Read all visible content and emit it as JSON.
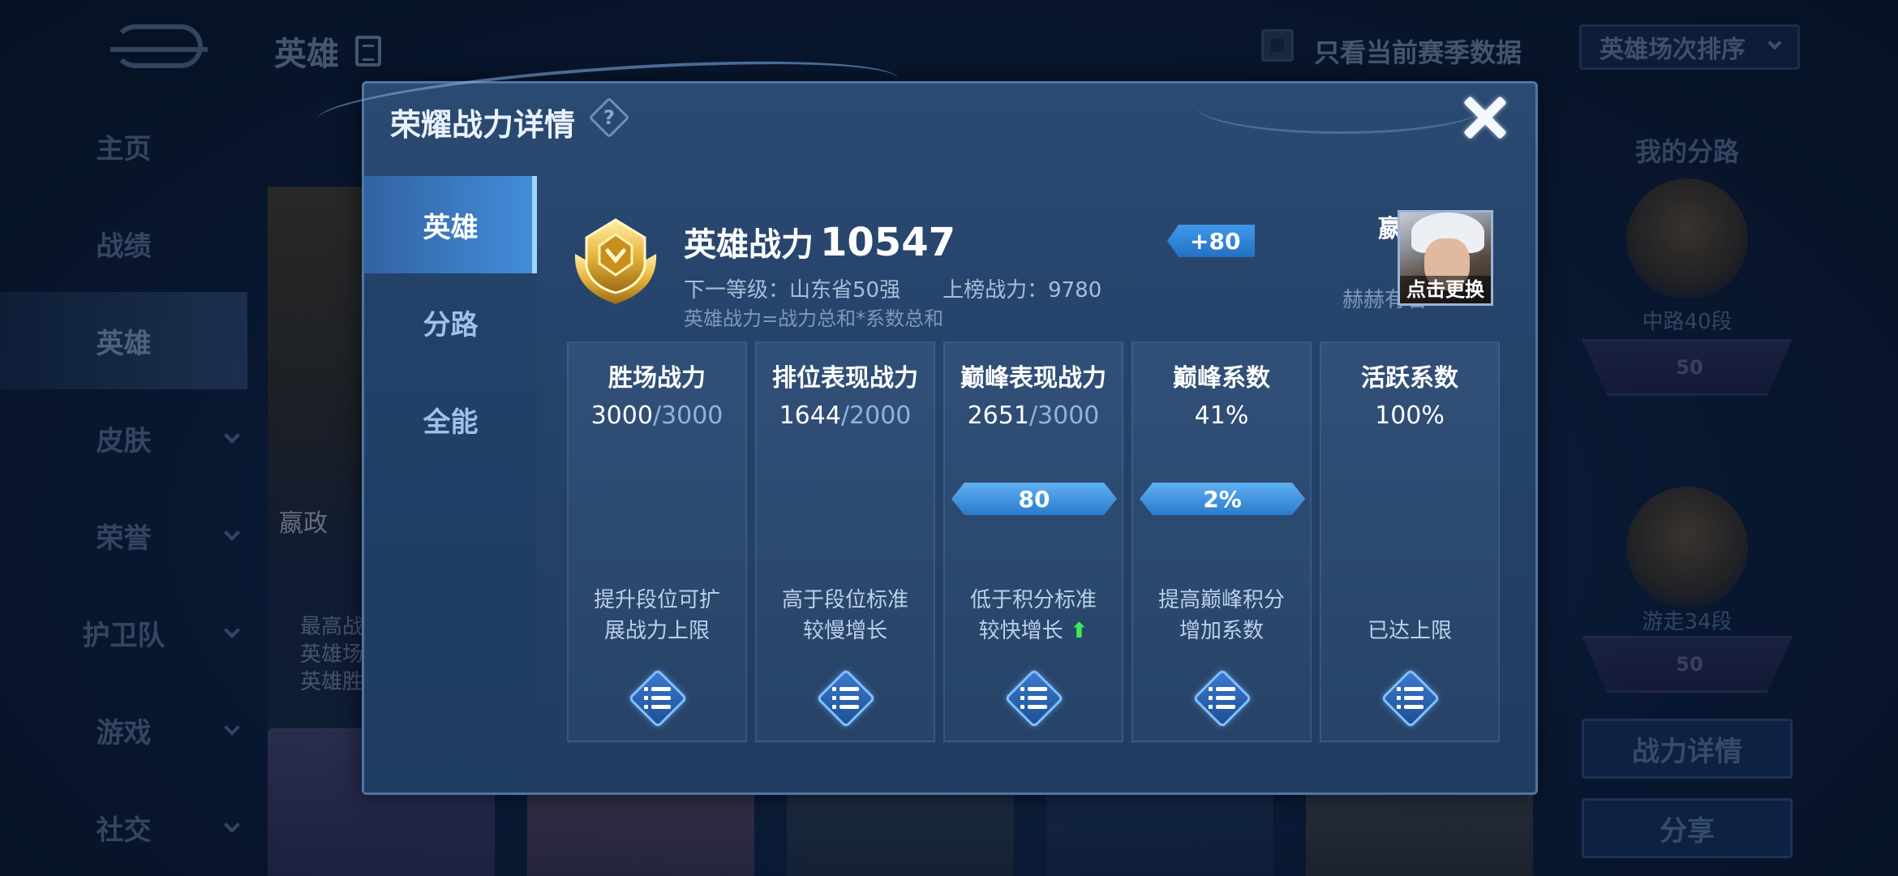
{
  "background": {
    "page_title": "英雄",
    "nav": [
      {
        "label": "主页",
        "has_chevron": false
      },
      {
        "label": "战绩",
        "has_chevron": false
      },
      {
        "label": "英雄",
        "has_chevron": false,
        "active": true
      },
      {
        "label": "皮肤",
        "has_chevron": true
      },
      {
        "label": "荣誉",
        "has_chevron": true
      },
      {
        "label": "护卫队",
        "has_chevron": true
      },
      {
        "label": "游戏",
        "has_chevron": true
      },
      {
        "label": "社交",
        "has_chevron": true
      }
    ],
    "filter_label": "只看当前赛季数据",
    "sort_label": "英雄场次排序",
    "hero_card_name": "嬴政",
    "hero_card_text": [
      "最高战",
      "英雄场",
      "英雄胜"
    ],
    "right_panel": {
      "title": "我的分路",
      "rank1_label": "中路40段",
      "rank1_plate": "50",
      "rank2_label": "游走34段",
      "rank2_plate": "50",
      "btn_detail": "战力详情",
      "btn_share": "分享"
    }
  },
  "modal": {
    "title": "荣耀战力详情",
    "help": "?",
    "tabs": [
      {
        "label": "英雄",
        "active": true
      },
      {
        "label": "分路",
        "active": false
      },
      {
        "label": "全能",
        "active": false
      }
    ],
    "summary": {
      "power_label": "英雄战力",
      "power_value": "10547",
      "delta": "+80",
      "next_level": "下一等级：山东省50强",
      "rank_power": "上榜战力：9780",
      "formula": "英雄战力=战力总和*系数总和"
    },
    "hero": {
      "name": "嬴政",
      "title": "赫赫有名",
      "change_label": "点击更换"
    },
    "stats": [
      {
        "title": "胜场战力",
        "current": "3000",
        "max": "/3000",
        "ribbon": null,
        "note": [
          "提升段位可扩",
          "展战力上限"
        ],
        "up_arrow": false
      },
      {
        "title": "排位表现战力",
        "current": "1644",
        "max": "/2000",
        "ribbon": null,
        "note": [
          "高于段位标准",
          "较慢增长"
        ],
        "up_arrow": false
      },
      {
        "title": "巅峰表现战力",
        "current": "2651",
        "max": "/3000",
        "ribbon": "80",
        "note": [
          "低于积分标准",
          "较快增长"
        ],
        "up_arrow": true
      },
      {
        "title": "巅峰系数",
        "current": "41%",
        "max": "",
        "ribbon": "2%",
        "note": [
          "提高巅峰积分",
          "增加系数"
        ],
        "up_arrow": false
      },
      {
        "title": "活跃系数",
        "current": "100%",
        "max": "",
        "ribbon": null,
        "note": [
          "",
          "已达上限"
        ],
        "up_arrow": false
      }
    ],
    "colors": {
      "accent": "#2f86d8",
      "up_arrow": "#3ee85a",
      "max_value": "#8fb3e2"
    }
  }
}
